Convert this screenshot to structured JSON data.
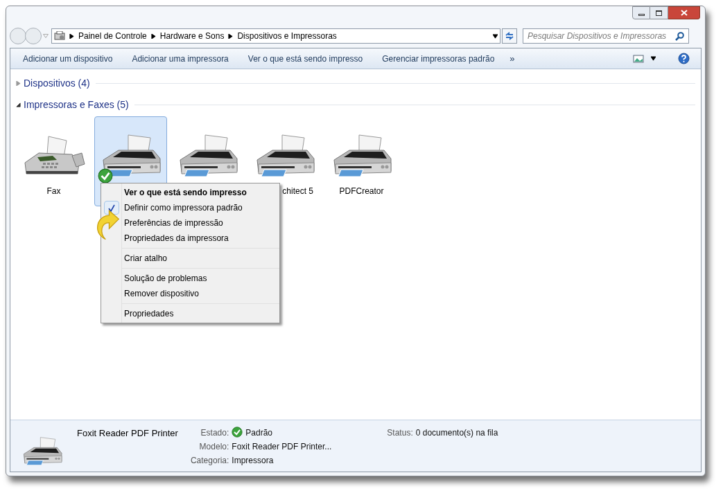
{
  "breadcrumb": [
    "Painel de Controle",
    "Hardware e Sons",
    "Dispositivos e Impressoras"
  ],
  "search": {
    "placeholder": "Pesquisar Dispositivos e Impressoras"
  },
  "toolbar": {
    "buttons": [
      "Adicionar um dispositivo",
      "Adicionar uma impressora",
      "Ver o que está sendo impresso",
      "Gerenciar impressoras padrão"
    ],
    "more": "»"
  },
  "groups": [
    {
      "title": "Dispositivos (4)",
      "expanded": false
    },
    {
      "title": "Impressoras e Faxes (5)",
      "expanded": true,
      "items": [
        {
          "kind": "fax",
          "label": "Fax",
          "selected": false,
          "default": false
        },
        {
          "kind": "printer",
          "selected": true,
          "default": true
        },
        {
          "kind": "printer",
          "selected": false,
          "default": false
        },
        {
          "kind": "printer",
          "label": "chitect 5",
          "label_cut": true,
          "selected": false,
          "default": false
        },
        {
          "kind": "printer",
          "label": "PDFCreator",
          "selected": false,
          "default": false
        }
      ]
    }
  ],
  "context_menu": {
    "sections": [
      [
        {
          "label": "Ver o que está sendo impresso",
          "bold": true,
          "checked": false
        },
        {
          "label": "Definir como impressora padrão",
          "bold": false,
          "checked": true
        },
        {
          "label": "Preferências de impressão",
          "bold": false,
          "checked": false
        },
        {
          "label": "Propriedades da impressora",
          "bold": false,
          "checked": false
        }
      ],
      [
        {
          "label": "Criar atalho",
          "bold": false,
          "checked": false
        }
      ],
      [
        {
          "label": "Solução de problemas",
          "bold": false,
          "checked": false
        },
        {
          "label": "Remover dispositivo",
          "bold": false,
          "checked": false
        }
      ],
      [
        {
          "label": "Propriedades",
          "bold": false,
          "checked": false
        }
      ]
    ]
  },
  "details": {
    "name": "Foxit Reader PDF Printer",
    "fields": [
      {
        "label": "Estado:",
        "value": "Padrão",
        "ok": true
      },
      {
        "label": "Modelo:",
        "value": "Foxit Reader PDF Printer...",
        "ok": false
      },
      {
        "label": "Categoria:",
        "value": "Impressora",
        "ok": false
      }
    ],
    "status": {
      "label": "Status:",
      "value": "0 documento(s) na fila"
    }
  }
}
